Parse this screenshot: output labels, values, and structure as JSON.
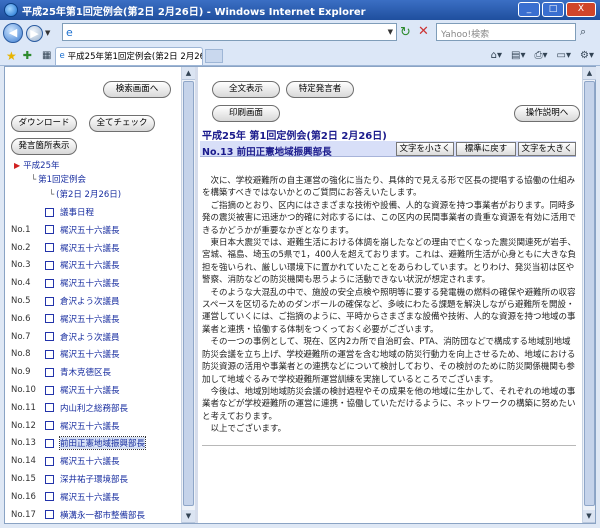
{
  "window": {
    "title": "平成25年第1回定例会(第2日 2月26日) - Windows Internet Explorer",
    "buttons": [
      "_",
      "□",
      "X"
    ]
  },
  "address_bar": {
    "url": "e",
    "search_placeholder": "Yahoo!検索"
  },
  "tab": {
    "title": "平成25年第1回定例会(第2日 2月26日)"
  },
  "left": {
    "buttons": {
      "search_screen": "検索画面へ",
      "download": "ダウンロード",
      "check_all": "全てチェック",
      "speaker_display": "発言箇所表示"
    },
    "tree": {
      "year": "平成25年",
      "session": "第1回定例会",
      "day": "(第2日 2月26日)"
    },
    "items": [
      {
        "no": "",
        "name": "議事日程"
      },
      {
        "no": "No.1",
        "name": "梶沢五十六議長"
      },
      {
        "no": "No.2",
        "name": "梶沢五十六議長"
      },
      {
        "no": "No.3",
        "name": "梶沢五十六議長"
      },
      {
        "no": "No.4",
        "name": "梶沢五十六議長"
      },
      {
        "no": "No.5",
        "name": "倉沢よう次議員"
      },
      {
        "no": "No.6",
        "name": "梶沢五十六議長"
      },
      {
        "no": "No.7",
        "name": "倉沢よう次議員"
      },
      {
        "no": "No.8",
        "name": "梶沢五十六議長"
      },
      {
        "no": "No.9",
        "name": "青木克德区長"
      },
      {
        "no": "No.10",
        "name": "梶沢五十六議長"
      },
      {
        "no": "No.11",
        "name": "内山利之総務部長"
      },
      {
        "no": "No.12",
        "name": "梶沢五十六議長"
      },
      {
        "no": "No.13",
        "name": "前田正憲地域振興部長",
        "selected": true
      },
      {
        "no": "No.14",
        "name": "梶沢五十六議長"
      },
      {
        "no": "No.15",
        "name": "深井祐子環境部長"
      },
      {
        "no": "No.16",
        "name": "梶沢五十六議長"
      },
      {
        "no": "No.17",
        "name": "横溝永一都市整備部長"
      }
    ]
  },
  "right": {
    "buttons": {
      "show_all": "全文表示",
      "specific_speaker": "特定発言者",
      "print_screen": "印刷画面",
      "manual": "操作説明へ"
    },
    "doc_title": "平成25年 第1回定例会(第2日 2月26日)",
    "speaker": "No.13 前田正憲地域振興部長",
    "font_buttons": {
      "smaller": "文字を小さく",
      "reset": "標準に戻す",
      "larger": "文字を大きく"
    },
    "paragraphs": [
      "次に、学校避難所の自主運営の強化に当たり、具体的で見える形で区長の提唱する協働の仕組みを構築すべきではないかとのご質問にお答えいたします。",
      "ご指摘のとおり、区内にはさまざまな技術や設備、人的な資源を持つ事業者がおります。同時多発の震災被害に迅速かつ的確に対応するには、この区内の民間事業者の貴重な資源を有効に活用できるかどうかが重要なかぎとなります。",
      "東日本大震災では、避難生活における体調を崩したなどの理由で亡くなった震災関連死が岩手、宮城、福島、埼玉の5県で1，400人を超えております。これは、避難所生活が心身ともに大きな負担を強いられ、厳しい環境下に置かれていたことをあらわしています。とりわけ、発災当初は区や警察、消防などの防災機関も思うように活動できない状況が想定されます。",
      "そのような大混乱の中で、施設の安全点検や照明等に要する発電機の燃料の確保や避難所の収容スペースを区切るためのダンボールの確保など、多岐にわたる課題を解決しながら避難所を開設・運営していくには、ご指摘のように、平時からさまざまな設備や技術、人的な資源を持つ地域の事業者と連携・協働する体制をつくっておく必要がございます。",
      "その一つの事例として、現在、区内2カ所で自治町会、PTA、消防団などで構成する地域別地域防災会議を立ち上げ、学校避難所の運営を含む地域の防災行動力を向上させるため、地域における防災資源の活用や事業者との連携などについて検討しており、その検討のために防災関係機関も参加して地域ぐるみで学校避難所運営訓練を実施しているところでございます。",
      "今後は、地域別地域防災会議の検討過程やその成果を他の地域に生かして、それぞれの地域の事業者などが学校避難所の運営に連携・協働していただけるように、ネットワークの構築に努めたいと考えております。",
      "以上でございます。"
    ]
  }
}
